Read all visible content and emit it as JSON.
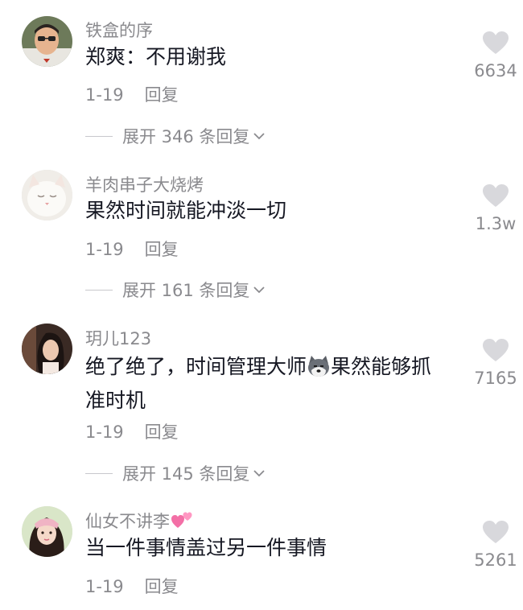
{
  "comments": [
    {
      "username": "铁盒的序",
      "text": "郑爽：不用谢我",
      "date": "1-19",
      "reply_label": "回复",
      "expand_label": "展开 346 条回复",
      "likes": "6634"
    },
    {
      "username": "羊肉串子大烧烤",
      "text": "果然时间就能冲淡一切",
      "date": "1-19",
      "reply_label": "回复",
      "expand_label": "展开 161 条回复",
      "likes": "1.3w"
    },
    {
      "username": "玥儿123",
      "text_before": "绝了绝了，时间管理大师",
      "text_emoji": "husky-emoji",
      "text_after": "果然能够抓准时机",
      "date": "1-19",
      "reply_label": "回复",
      "expand_label": "展开 145 条回复",
      "likes": "7165"
    },
    {
      "username": "仙女不讲李",
      "username_emoji": "two-hearts-emoji",
      "text": "当一件事情盖过另一件事情",
      "date": "1-19",
      "reply_label": "回复",
      "likes": "5261"
    }
  ],
  "colors": {
    "primary_text": "#161823",
    "secondary_text": "#8a8a8e",
    "heart": "#d8d8dc"
  }
}
